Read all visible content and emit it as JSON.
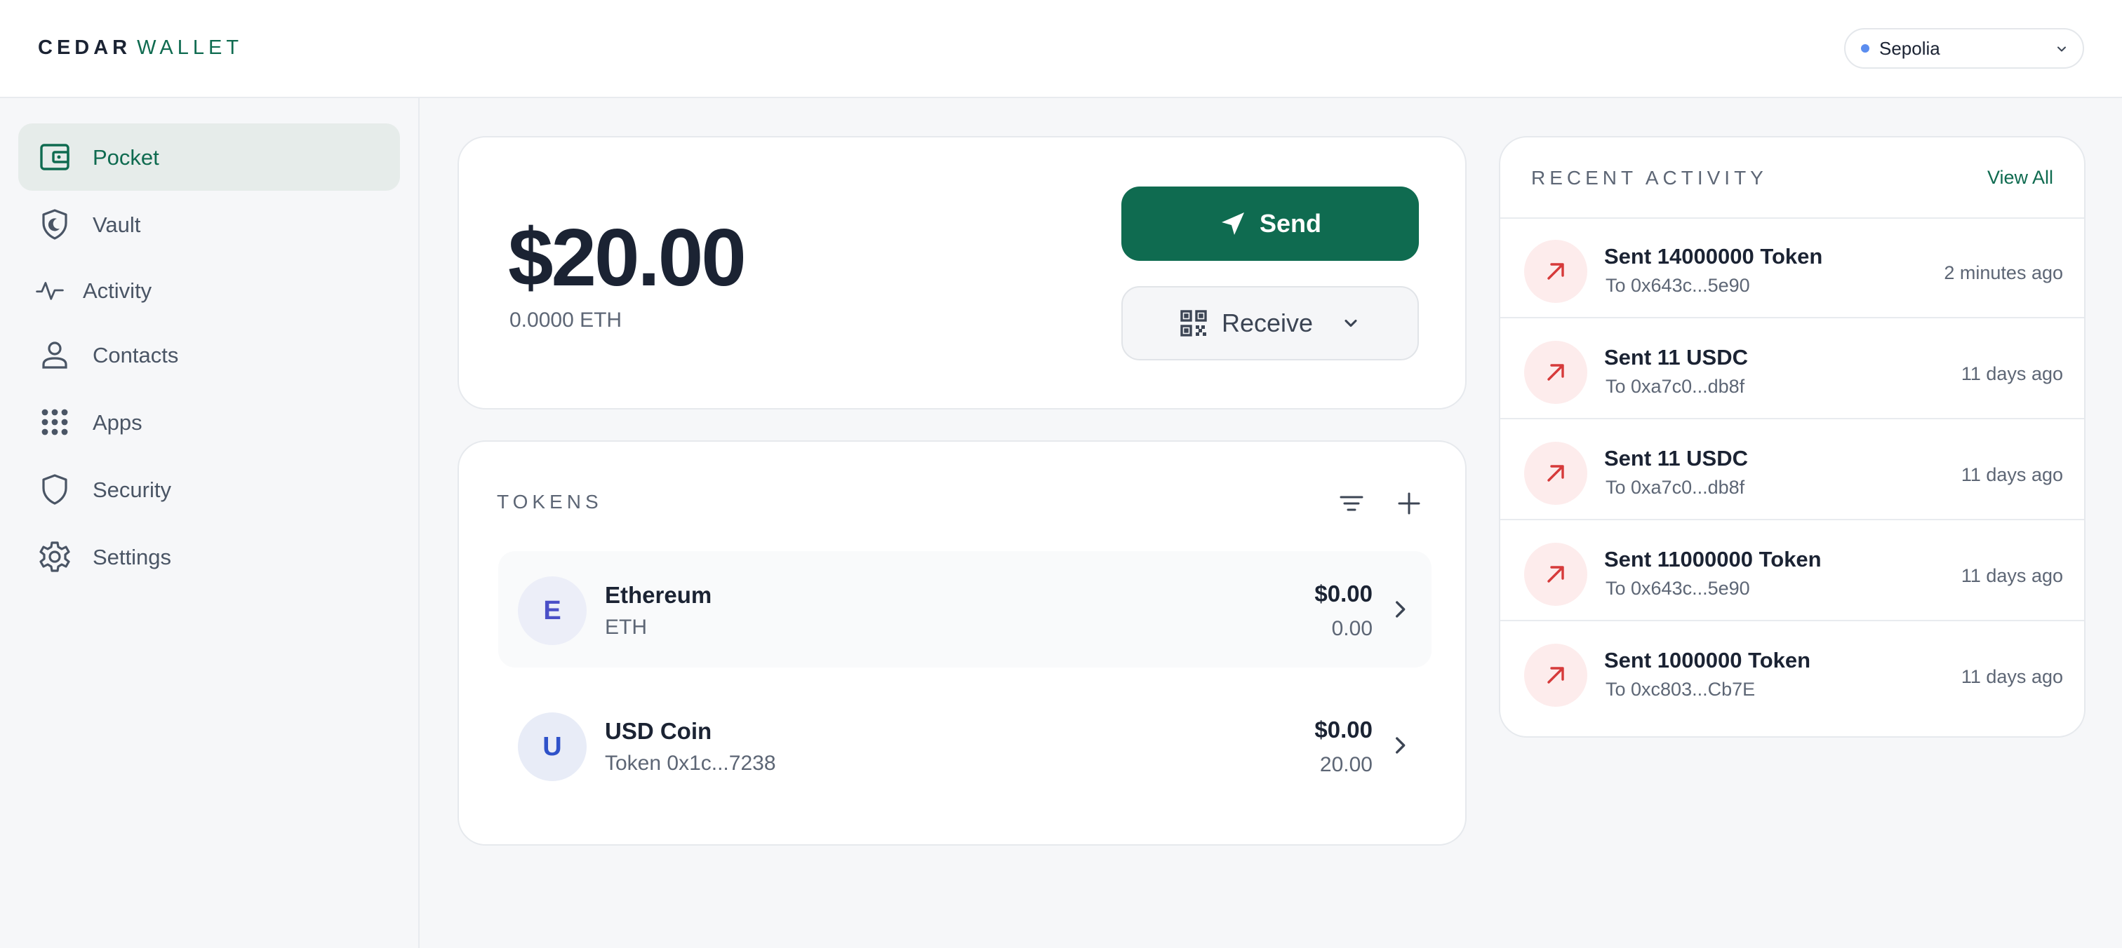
{
  "app": {
    "logo_primary": "CEDAR",
    "logo_secondary": "WALLET"
  },
  "network": {
    "name": "Sepolia",
    "status_color": "#5b8def"
  },
  "sidebar": {
    "items": [
      {
        "label": "Pocket",
        "icon": "wallet-icon",
        "active": true
      },
      {
        "label": "Vault",
        "icon": "shield-moon-icon",
        "active": false
      },
      {
        "label": "Activity",
        "icon": "pulse-icon",
        "active": false
      },
      {
        "label": "Contacts",
        "icon": "person-icon",
        "active": false
      },
      {
        "label": "Apps",
        "icon": "grid-dots-icon",
        "active": false
      },
      {
        "label": "Security",
        "icon": "shield-icon",
        "active": false
      },
      {
        "label": "Settings",
        "icon": "gear-icon",
        "active": false
      }
    ]
  },
  "balance": {
    "amount": "$20.00",
    "eth": "0.0000 ETH",
    "send_label": "Send",
    "receive_label": "Receive"
  },
  "tokens": {
    "title": "TOKENS",
    "items": [
      {
        "avatar": "E",
        "name": "Ethereum",
        "sub": "ETH",
        "usd": "$0.00",
        "qty": "0.00"
      },
      {
        "avatar": "U",
        "name": "USD Coin",
        "sub": "Token 0x1c...7238",
        "usd": "$0.00",
        "qty": "20.00"
      }
    ]
  },
  "activity": {
    "title": "RECENT ACTIVITY",
    "view_all": "View All",
    "items": [
      {
        "title": "Sent 14000000 Token",
        "to": "To 0x643c...5e90",
        "time": "2 minutes ago"
      },
      {
        "title": "Sent 11 USDC",
        "to": "To 0xa7c0...db8f",
        "time": "11 days ago"
      },
      {
        "title": "Sent 11 USDC",
        "to": "To 0xa7c0...db8f",
        "time": "11 days ago"
      },
      {
        "title": "Sent 11000000 Token",
        "to": "To 0x643c...5e90",
        "time": "11 days ago"
      },
      {
        "title": "Sent 1000000 Token",
        "to": "To 0xc803...Cb7E",
        "time": "11 days ago"
      }
    ]
  },
  "colors": {
    "brand": "#0f6b50",
    "sent_icon_bg": "#fdecec",
    "sent_icon_fg": "#d63a3a"
  }
}
